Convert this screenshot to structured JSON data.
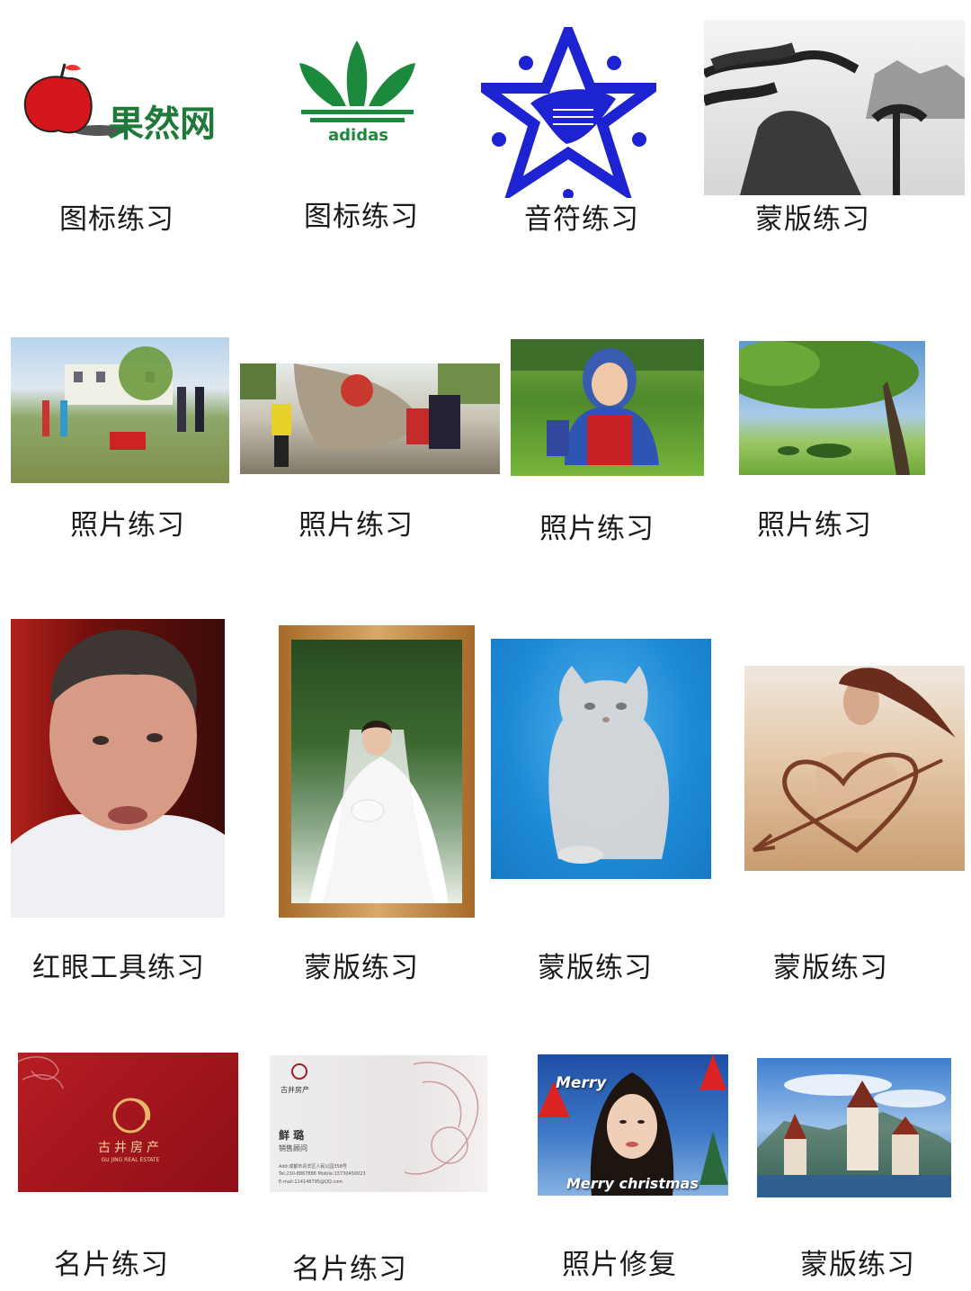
{
  "logos": {
    "guoran_text": "果然网",
    "adidas_text": "adidas"
  },
  "cards": {
    "red_company": "古井房产",
    "red_company_en": "GU JING REAL ESTATE",
    "white_company": "古井房产",
    "white_person": "鲜 璐",
    "white_title": "销售顾问",
    "white_addr": "Add:成都市青羊区人民公园358号",
    "white_tel": "Tel:230-8867886   Mobile:15730450023",
    "white_email": "E-mail:114148795@QQ.com"
  },
  "xmas": {
    "top": "Merry",
    "bottom": "Merry christmas"
  },
  "captions": [
    "图标练习",
    "图标练习",
    "音符练习",
    "蒙版练习",
    "照片练习",
    "照片练习",
    "照片练习",
    "照片练习",
    "红眼工具练习",
    "蒙版练习",
    "蒙版练习",
    "蒙版练习",
    "名片练习",
    "名片练习",
    "照片修复",
    "蒙版练习"
  ]
}
